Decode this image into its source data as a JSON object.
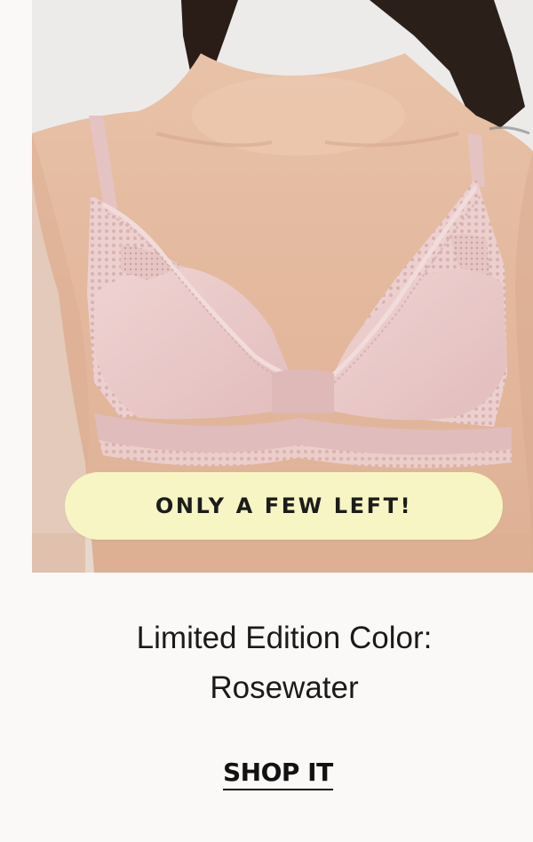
{
  "hero": {
    "image_icon": "product-photo-icon",
    "badge_label": "ONLY A FEW LEFT!"
  },
  "headline": {
    "line1": "Limited Edition Color:",
    "line2": "Rosewater"
  },
  "cta": {
    "label": "SHOP IT"
  },
  "colors": {
    "page_background": "#faf9f7",
    "badge_background": "#f7f5c3",
    "product_pink": "#e9c9c9",
    "text": "#1a1a1a"
  }
}
